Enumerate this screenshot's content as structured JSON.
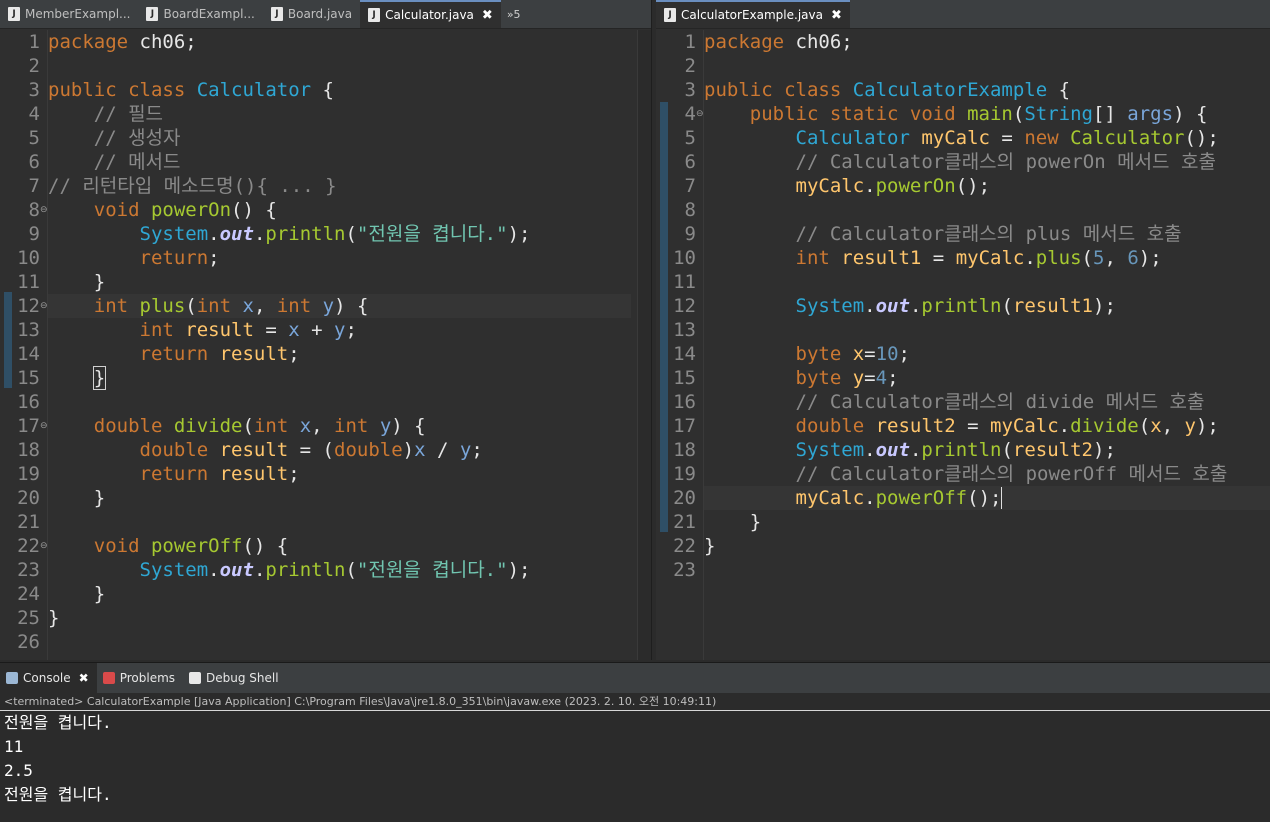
{
  "left_editor": {
    "tabs": [
      {
        "label": "MemberExampl...",
        "active": false
      },
      {
        "label": "BoardExampl...",
        "active": false
      },
      {
        "label": "Board.java",
        "active": false
      },
      {
        "label": "Calculator.java",
        "active": true
      }
    ],
    "overflow_label": "»5",
    "line_numbers": [
      "1",
      "2",
      "3",
      "4",
      "5",
      "6",
      "7",
      "8",
      "9",
      "10",
      "11",
      "12",
      "13",
      "14",
      "15",
      "16",
      "17",
      "18",
      "19",
      "20",
      "21",
      "22",
      "23",
      "24",
      "25",
      "26"
    ]
  },
  "right_editor": {
    "tabs": [
      {
        "label": "CalculatorExample.java",
        "active": true
      }
    ],
    "line_numbers": [
      "1",
      "2",
      "3",
      "4",
      "5",
      "6",
      "7",
      "8",
      "9",
      "10",
      "11",
      "12",
      "13",
      "14",
      "15",
      "16",
      "17",
      "18",
      "19",
      "20",
      "21",
      "22",
      "23"
    ]
  },
  "console": {
    "tabs": [
      {
        "label": "Console",
        "active": true
      },
      {
        "label": "Problems",
        "active": false
      },
      {
        "label": "Debug Shell",
        "active": false
      }
    ],
    "status": "<terminated> CalculatorExample [Java Application] C:\\Program Files\\Java\\jre1.8.0_351\\bin\\javaw.exe (2023. 2. 10. 오전 10:49:11)",
    "output": [
      "전원을 켭니다.",
      "11",
      "2.5",
      "전원을 켭니다."
    ]
  },
  "colors": {
    "editor_bg": "#2f2f2f",
    "keyword": "#cc7832",
    "class": "#2fa7d4",
    "method": "#a6c931",
    "variable": "#ffc66d",
    "string": "#71c6b1"
  }
}
